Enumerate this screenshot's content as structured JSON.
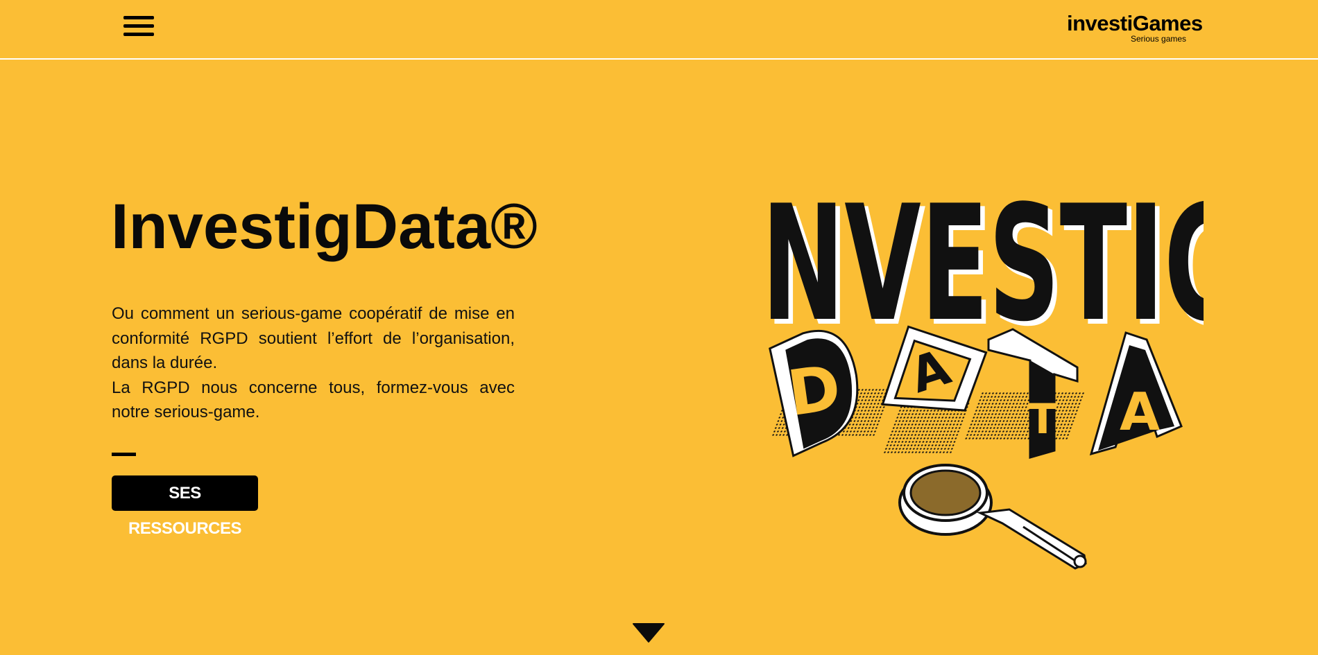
{
  "header": {
    "menu_icon": "hamburger-menu-icon",
    "logo": {
      "name": "investiGames",
      "tagline": "Serious games"
    }
  },
  "hero": {
    "title": "InvestigData®",
    "description": [
      "Ou comment un serious-game coopératif de mise en conformité RGPD soutient l’effort de l’organisation, dans la durée.",
      "La RGPD nous concerne tous, formez-vous avec notre serious-game."
    ],
    "cta_label": "SES RESSOURCES"
  },
  "illustration": {
    "line1": "INVESTIG",
    "line2": [
      "D",
      "A",
      "T",
      "A"
    ],
    "icon": "magnifying-glass-icon"
  },
  "scroll_icon": "chevron-down-icon",
  "colors": {
    "background": "#FBBE35",
    "text": "#111111",
    "button_bg": "#000000",
    "button_text": "#ffffff",
    "lens": "#8B6A2B"
  }
}
